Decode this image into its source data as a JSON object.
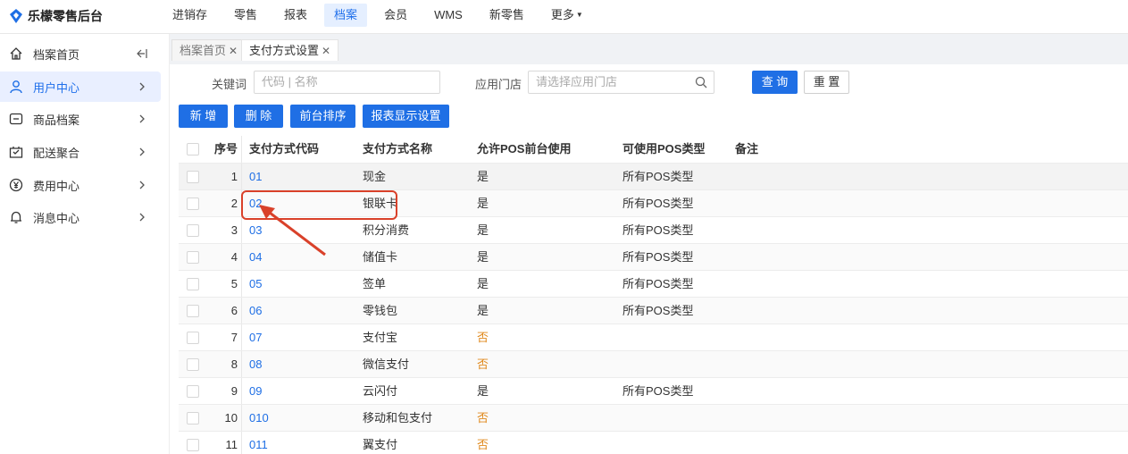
{
  "app": {
    "title": "乐檬零售后台"
  },
  "topnav": {
    "items": [
      {
        "label": "进销存"
      },
      {
        "label": "零售"
      },
      {
        "label": "报表"
      },
      {
        "label": "档案"
      },
      {
        "label": "会员"
      },
      {
        "label": "WMS"
      },
      {
        "label": "新零售"
      },
      {
        "label": "更多"
      }
    ],
    "active": "档案"
  },
  "sidebar": {
    "items": [
      {
        "label": "档案首页",
        "icon": "home-icon"
      },
      {
        "label": "用户中心",
        "icon": "user-icon"
      },
      {
        "label": "商品档案",
        "icon": "product-icon"
      },
      {
        "label": "配送聚合",
        "icon": "delivery-icon"
      },
      {
        "label": "费用中心",
        "icon": "yen-icon"
      },
      {
        "label": "消息中心",
        "icon": "bell-icon"
      }
    ],
    "active": "用户中心"
  },
  "tabs": [
    {
      "label": "档案首页",
      "active": false
    },
    {
      "label": "支付方式设置",
      "active": true
    }
  ],
  "filters": {
    "keyword_label": "关键词",
    "keyword_placeholder": "代码 | 名称",
    "store_label": "应用门店",
    "store_placeholder": "请选择应用门店",
    "query_label": "查 询",
    "reset_label": "重 置"
  },
  "toolbar": {
    "add_label": "新 增",
    "delete_label": "删 除",
    "sort_label": "前台排序",
    "report_label": "报表显示设置"
  },
  "table": {
    "headers": [
      "序号",
      "支付方式代码",
      "支付方式名称",
      "允许POS前台使用",
      "可使用POS类型",
      "备注"
    ],
    "rows": [
      {
        "idx": "1",
        "code": "01",
        "name": "现金",
        "allow": "是",
        "pos": "所有POS类型"
      },
      {
        "idx": "2",
        "code": "02",
        "name": "银联卡",
        "allow": "是",
        "pos": "所有POS类型"
      },
      {
        "idx": "3",
        "code": "03",
        "name": "积分消费",
        "allow": "是",
        "pos": "所有POS类型"
      },
      {
        "idx": "4",
        "code": "04",
        "name": "储值卡",
        "allow": "是",
        "pos": "所有POS类型"
      },
      {
        "idx": "5",
        "code": "05",
        "name": "签单",
        "allow": "是",
        "pos": "所有POS类型"
      },
      {
        "idx": "6",
        "code": "06",
        "name": "零钱包",
        "allow": "是",
        "pos": "所有POS类型"
      },
      {
        "idx": "7",
        "code": "07",
        "name": "支付宝",
        "allow": "否",
        "pos": ""
      },
      {
        "idx": "8",
        "code": "08",
        "name": "微信支付",
        "allow": "否",
        "pos": ""
      },
      {
        "idx": "9",
        "code": "09",
        "name": "云闪付",
        "allow": "是",
        "pos": "所有POS类型"
      },
      {
        "idx": "10",
        "code": "010",
        "name": "移动和包支付",
        "allow": "否",
        "pos": ""
      },
      {
        "idx": "11",
        "code": "011",
        "name": "翼支付",
        "allow": "否",
        "pos": ""
      }
    ]
  },
  "colors": {
    "accent": "#1f6fe5",
    "highlight": "#d9412a",
    "no_value": "#e08a1e"
  }
}
